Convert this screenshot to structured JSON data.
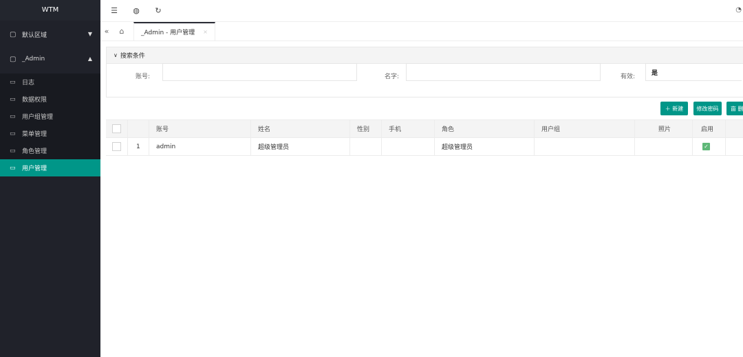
{
  "sidebar": {
    "brand": "WTM",
    "groups": [
      {
        "label": "默认区域"
      },
      {
        "label": "_Admin"
      }
    ],
    "items": [
      {
        "label": "日志"
      },
      {
        "label": "数据权限"
      },
      {
        "label": "用户组管理"
      },
      {
        "label": "菜单管理"
      },
      {
        "label": "角色管理"
      },
      {
        "label": "用户管理"
      }
    ]
  },
  "tabs": {
    "active_label": "_Admin - 用户管理",
    "close_glyph": "×"
  },
  "search": {
    "title": "搜索条件",
    "fields": {
      "account_label": "账号:",
      "account_value": "",
      "name_label": "名字:",
      "name_value": "",
      "valid_label": "有效:",
      "valid_value": "是"
    }
  },
  "actions": {
    "new_label": "＋ 新建",
    "change_password_label": "修改密码",
    "delete_label": "亩 删"
  },
  "table": {
    "headers": {
      "account": "账号",
      "name": "姓名",
      "gender": "性别",
      "phone": "手机",
      "role": "角色",
      "group": "用户组",
      "photo": "照片",
      "enabled": "启用"
    },
    "rows": [
      {
        "index": "1",
        "account": "admin",
        "name": "超级管理员",
        "gender": "",
        "phone": "",
        "role": "超级管理员",
        "group": "",
        "photo": "",
        "enabled_glyph": "✓"
      }
    ]
  },
  "colors": {
    "sidebar_bg": "#20222a",
    "accent": "#009688",
    "check_green": "#5fb878"
  }
}
